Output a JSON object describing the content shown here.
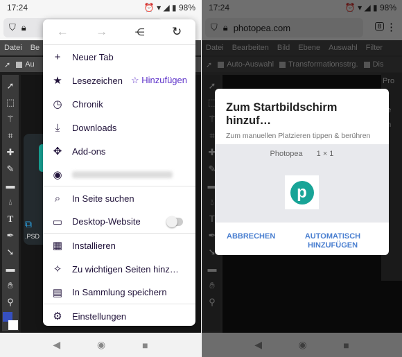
{
  "status": {
    "time": "17:24",
    "battery": "98%"
  },
  "left": {
    "menubar": [
      "Datei",
      "Be"
    ],
    "options": [
      "Au"
    ],
    "psd_label": ".PSD",
    "menu": {
      "nav_icons": [
        "back-arrow-icon",
        "forward-arrow-icon",
        "share-icon",
        "reload-icon"
      ],
      "items": [
        {
          "icon": "plus-icon",
          "glyph": "+",
          "label": "Neuer Tab"
        },
        {
          "icon": "bookmark-star-icon",
          "glyph": "★",
          "label": "Lesezeichen",
          "extra": "☆ Hinzufügen",
          "divider": false
        },
        {
          "icon": "history-clock-icon",
          "glyph": "◷",
          "label": "Chronik"
        },
        {
          "icon": "download-icon",
          "glyph": "⤓",
          "label": "Downloads"
        },
        {
          "icon": "puzzle-icon",
          "glyph": "✥",
          "label": "Add-ons"
        },
        {
          "icon": "account-icon",
          "glyph": "◉",
          "label": "",
          "blurred": true,
          "divider": true
        },
        {
          "icon": "search-icon",
          "glyph": "⌕",
          "label": "In Seite suchen"
        },
        {
          "icon": "laptop-icon",
          "glyph": "▭",
          "label": "Desktop-Website",
          "toggle": false,
          "divider": true
        },
        {
          "icon": "install-icon",
          "glyph": "▦",
          "label": "Installieren"
        },
        {
          "icon": "pin-icon",
          "glyph": "✧",
          "label": "Zu wichtigen Seiten hinz…"
        },
        {
          "icon": "collection-icon",
          "glyph": "▤",
          "label": "In Sammlung speichern",
          "divider": true
        },
        {
          "icon": "gear-icon",
          "glyph": "⚙",
          "label": "Einstellungen"
        }
      ]
    }
  },
  "right": {
    "url": "photopea.com",
    "tab_count": "8",
    "menubar": [
      "Datei",
      "Bearbeiten",
      "Bild",
      "Ebene",
      "Auswahl",
      "Filter"
    ],
    "options": [
      "Auto-Auswahl",
      "Transformationsstrg.",
      "Dis"
    ],
    "panel": [
      "Pro",
      "ar",
      "pe",
      "an",
      "a"
    ],
    "dialog": {
      "title": "Zum Startbildschirm hinzuf…",
      "subtitle": "Zum manuellen Platzieren tippen & berühren",
      "app_name": "Photopea",
      "size": "1 × 1",
      "cancel": "ABBRECHEN",
      "add": "AUTOMATISCH HINZUFÜGEN"
    }
  },
  "colors": {
    "accent": "#5b2fc8",
    "dialog_button": "#4a7fd0",
    "photopea": "#18a497"
  }
}
